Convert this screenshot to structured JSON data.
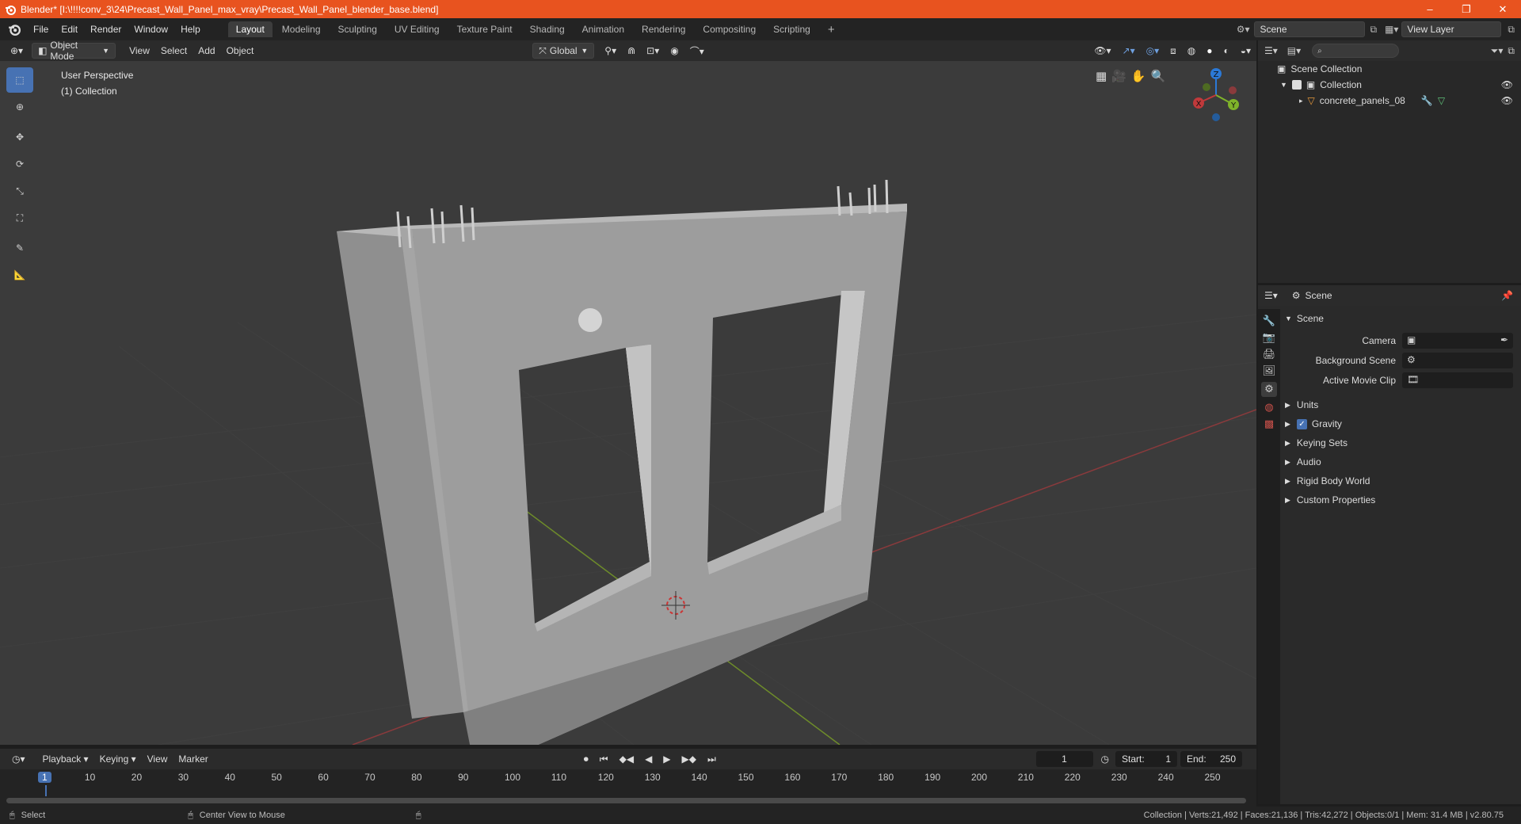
{
  "window": {
    "title": "Blender* [I:\\!!!!conv_3\\24\\Precast_Wall_Panel_max_vray\\Precast_Wall_Panel_blender_base.blend]",
    "minimize": "–",
    "maximize": "❐",
    "close": "✕"
  },
  "menu": [
    "File",
    "Edit",
    "Render",
    "Window",
    "Help"
  ],
  "workspaces": [
    "Layout",
    "Modeling",
    "Sculpting",
    "UV Editing",
    "Texture Paint",
    "Shading",
    "Animation",
    "Rendering",
    "Compositing",
    "Scripting"
  ],
  "workspace_add": "+",
  "scene_name": "Scene",
  "view_layer": "View Layer",
  "viewport": {
    "mode": "Object Mode",
    "menus": [
      "View",
      "Select",
      "Add",
      "Object"
    ],
    "orientation": "Global",
    "info_line1": "User Perspective",
    "info_line2": "(1) Collection",
    "gizmo": {
      "x": "X",
      "y": "Y",
      "z": "Z"
    }
  },
  "outliner": {
    "root": "Scene Collection",
    "collection": "Collection",
    "object": "concrete_panels_08"
  },
  "properties": {
    "header": "Scene",
    "section": "Scene",
    "camera_label": "Camera",
    "bg_scene_label": "Background Scene",
    "movie_clip_label": "Active Movie Clip",
    "panels": [
      "Units",
      "Gravity",
      "Keying Sets",
      "Audio",
      "Rigid Body World",
      "Custom Properties"
    ]
  },
  "timeline": {
    "menus": [
      "Playback",
      "Keying",
      "View",
      "Marker"
    ],
    "current_frame": "1",
    "start_label": "Start:",
    "start": "1",
    "end_label": "End:",
    "end": "250",
    "ruler": [
      "1",
      "10",
      "20",
      "30",
      "40",
      "50",
      "60",
      "70",
      "80",
      "90",
      "100",
      "110",
      "120",
      "130",
      "140",
      "150",
      "160",
      "170",
      "180",
      "190",
      "200",
      "210",
      "220",
      "230",
      "240",
      "250"
    ]
  },
  "status": {
    "select": "Select",
    "center": "Center View to Mouse",
    "stats": "Collection | Verts:21,492 | Faces:21,136 | Tris:42,272 | Objects:0/1 | Mem: 31.4 MB | v2.80.75"
  },
  "colors": {
    "title_bar": "#e8531f",
    "accent": "#4772b3",
    "x_axis": "#c0393b",
    "y_axis": "#7fb32a",
    "z_axis": "#2b79d6"
  }
}
